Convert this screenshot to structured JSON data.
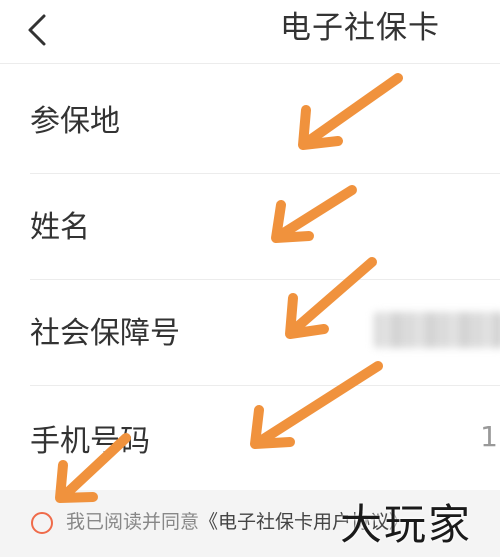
{
  "header": {
    "title": "电子社保卡",
    "back_icon": "chevron-left-icon"
  },
  "form": {
    "rows": [
      {
        "label": "参保地",
        "value": ""
      },
      {
        "label": "姓名",
        "value": ""
      },
      {
        "label": "社会保障号",
        "value": ""
      },
      {
        "label": "手机号码",
        "value": "1"
      }
    ]
  },
  "agreement": {
    "prefix": "我已阅读并同意",
    "link": "《电子社保卡用户协议》",
    "radio_color": "#ef6b4a"
  },
  "watermark": {
    "text": "大玩家"
  },
  "annotation": {
    "arrow_color": "#f0923d",
    "arrow_icon": "arrow-pointer-icon"
  },
  "colors": {
    "accent": "#f0923d",
    "text": "#333333",
    "divider": "#ececec"
  }
}
